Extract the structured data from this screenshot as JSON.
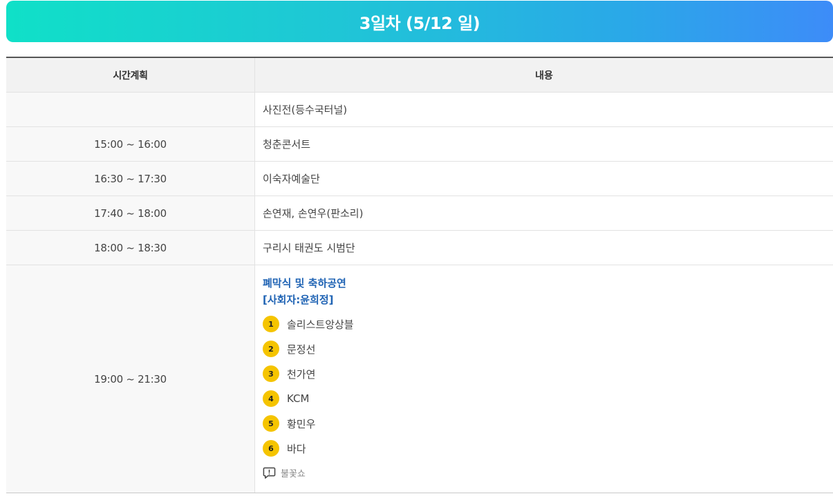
{
  "banner": {
    "title": "3일차 (5/12 일)"
  },
  "table": {
    "headers": {
      "time": "시간계획",
      "content": "내용"
    },
    "rows": [
      {
        "time": "",
        "content": "사진전(등수국터널)"
      },
      {
        "time": "15:00 ~ 16:00",
        "content": "청춘콘서트"
      },
      {
        "time": "16:30 ~ 17:30",
        "content": "이숙자예술단"
      },
      {
        "time": "17:40 ~ 18:00",
        "content": "손연재, 손연우(판소리)"
      },
      {
        "time": "18:00 ~ 18:30",
        "content": "구리시 태권도 시범단"
      }
    ],
    "closing": {
      "time": "19:00 ~ 21:30",
      "title": "폐막식 및 축하공연",
      "host": "[사회자:윤희정]",
      "performers": [
        {
          "num": "1",
          "name": "솔리스트앙상블"
        },
        {
          "num": "2",
          "name": "문정선"
        },
        {
          "num": "3",
          "name": "천가연"
        },
        {
          "num": "4",
          "name": "KCM"
        },
        {
          "num": "5",
          "name": "황민우"
        },
        {
          "num": "6",
          "name": "바다"
        }
      ],
      "note": {
        "icon": "speech-bubble-alert-icon",
        "text": "불꽃쇼"
      }
    }
  },
  "colors": {
    "banner_gradient_start": "#10e0c8",
    "banner_gradient_end": "#3d8cf8",
    "badge": "#f5c400",
    "highlight_text": "#1f63b4"
  }
}
